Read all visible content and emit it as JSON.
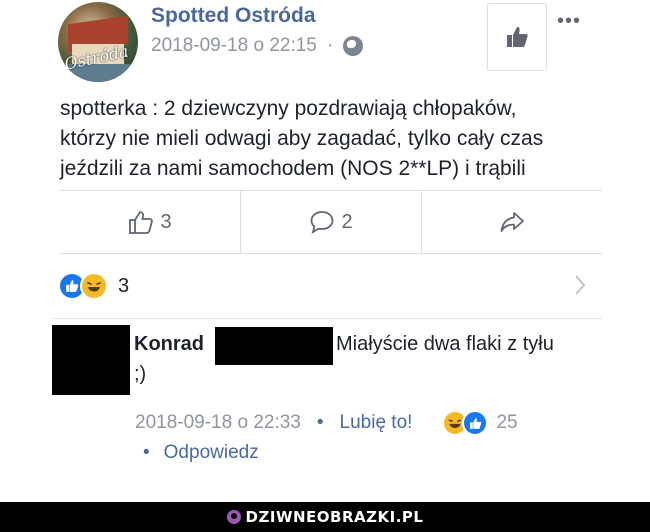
{
  "post": {
    "page_name": "Spotted Ostróda",
    "timestamp": "2018-09-18 o 22:15",
    "meta_separator": "·",
    "avatar_script_text": "Ostróda",
    "icons": {
      "privacy": "globe-icon",
      "like_page": "thumbs-up-icon",
      "more": "more-icon"
    },
    "text_lines": [
      "spotterka : 2 dziewczyny pozdrawiają chłopaków,",
      "którzy nie mieli odwagi aby zagadać, tylko cały czas",
      "jeździli za nami samochodem (NOS 2**LP) i trąbili"
    ],
    "more_label": "•••"
  },
  "actions": {
    "like_count": "3",
    "comment_count": "2",
    "icons": [
      "thumbs-up-icon",
      "comment-icon",
      "share-icon"
    ]
  },
  "reactions": {
    "count": "3",
    "types": [
      "like",
      "haha"
    ]
  },
  "comment": {
    "author": "Konrad",
    "text_line1": "Miałyście dwa flaki z tyłu",
    "text_line2": ";)",
    "timestamp": "2018-09-18 o 22:33",
    "separator": "•",
    "like_label": "Lubię to!",
    "reaction_count": "25",
    "reply_label": "Odpowiedz"
  },
  "watermark": {
    "text": "DZIWNEOBRAZKI.PL"
  },
  "colors": {
    "link_blue": "#4b67a1",
    "meta_gray": "#90949c",
    "like_blue": "#1877f2",
    "haha_yellow": "#f7b928"
  }
}
